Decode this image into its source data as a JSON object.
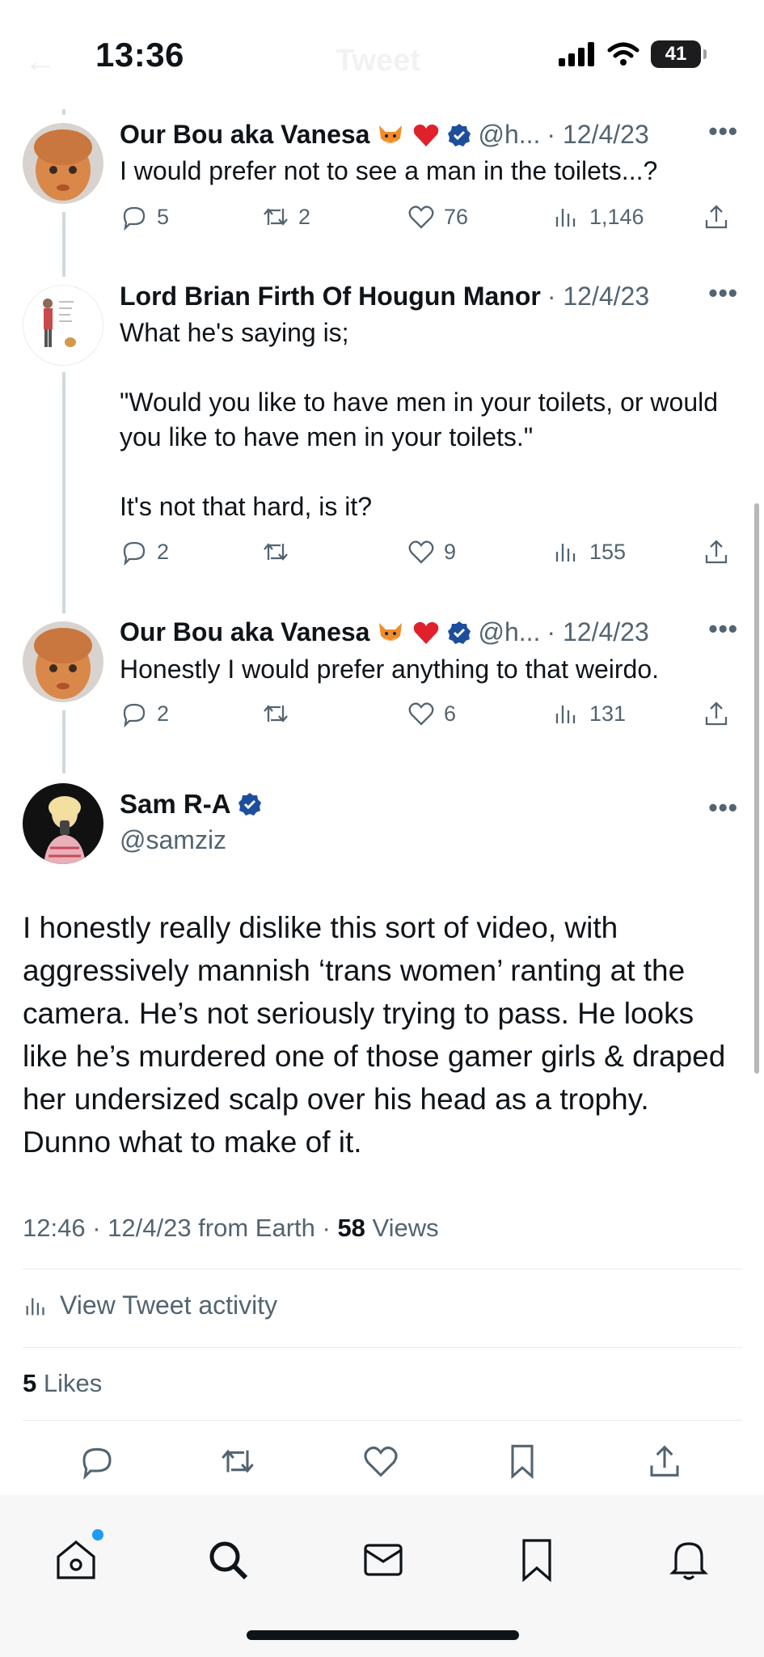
{
  "status_bar": {
    "time": "13:36",
    "battery": "41"
  },
  "header": {
    "title": "Tweet"
  },
  "replies": [
    {
      "name": "Our Bou aka Vanesa",
      "handle": "@h...",
      "date": "· 12/4/23",
      "text": "I would prefer not to see a man in the toilets...?",
      "replies": "5",
      "retweets": "2",
      "likes": "76",
      "views": "1,146"
    },
    {
      "name": "Lord Brian Firth Of Hougun Manor",
      "date": "· 12/4/23",
      "text_lines": [
        "What he's saying is;",
        "\"Would you like to have men in your toilets, or would you like to have men in your toilets.\"",
        "It's not that hard, is it?"
      ],
      "replies": "2",
      "retweets": "",
      "likes": "9",
      "views": "155"
    },
    {
      "name": "Our Bou aka Vanesa",
      "handle": "@h...",
      "date": "· 12/4/23",
      "text": "Honestly I would prefer anything to that weirdo.",
      "replies": "2",
      "retweets": "",
      "likes": "6",
      "views": "131"
    }
  ],
  "main_tweet": {
    "name": "Sam R-A",
    "handle": "@samziz",
    "text": "I honestly really dislike this sort of video, with aggressively mannish ‘trans women’ ranting at the camera. He’s not seriously trying to pass. He looks like he’s murdered one of those gamer girls & draped her undersized scalp over his head as a trophy. Dunno what to make of it.",
    "meta_prefix": "12:46 · 12/4/23 from Earth · ",
    "views_count": "58",
    "views_label": " Views",
    "activity_label": "View Tweet activity",
    "likes_count": "5",
    "likes_label": " Likes"
  },
  "icons": {
    "reply": "reply-icon",
    "retweet": "retweet-icon",
    "like": "heart-icon",
    "views": "views-icon",
    "share": "share-icon",
    "bookmark": "bookmark-icon",
    "home": "home-icon",
    "search": "search-icon",
    "messages": "mail-icon",
    "notifications": "bell-icon"
  },
  "colors": {
    "accent": "#1d9bf0",
    "verified": "#1d4e9e",
    "muted": "#536471"
  }
}
